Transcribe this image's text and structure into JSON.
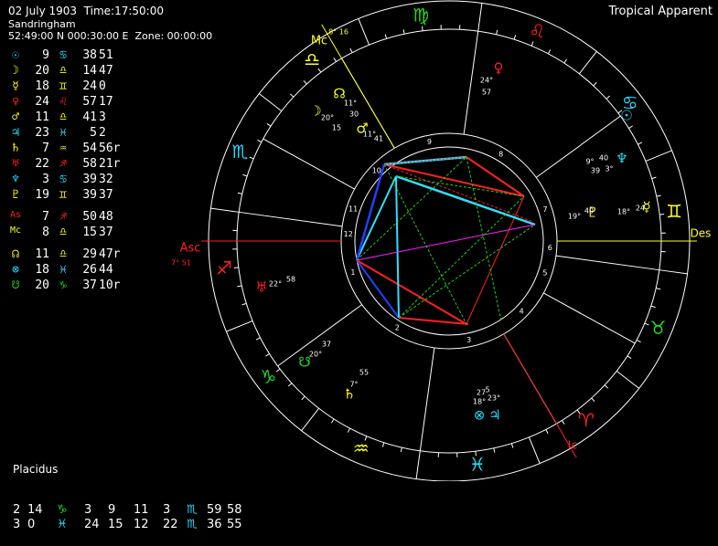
{
  "header": {
    "date": "02 July 1903",
    "time": "Time:17:50:00",
    "place": "Sandringham",
    "coords": "52:49:00 N 000:30:00 E  Zone: 00:00:00",
    "mode": "Tropical Apparent"
  },
  "colors": {
    "background": "#000000",
    "fire": "#ff2020",
    "earth": "#22dd22",
    "air": "#ffff22",
    "water": "#22ddff",
    "aspect_red": "#ff2020",
    "aspect_blue": "#2040ff",
    "aspect_cyan": "#30e0ff",
    "aspect_green": "#20cc20",
    "aspect_magenta": "#ff20ff"
  },
  "planets": [
    {
      "glyph": "☉",
      "name": "Sun",
      "deg": "9",
      "sign": "♋",
      "min": "38",
      "sec": "51",
      "color": "#22ddff"
    },
    {
      "glyph": "☽",
      "name": "Moon",
      "deg": "20",
      "sign": "♎",
      "min": "14",
      "sec": "47",
      "color": "#ffff22"
    },
    {
      "glyph": "☿",
      "name": "Mercury",
      "deg": "18",
      "sign": "♊",
      "min": "24",
      "sec": "0",
      "color": "#ffff22"
    },
    {
      "glyph": "♀",
      "name": "Venus",
      "deg": "24",
      "sign": "♌",
      "min": "57",
      "sec": "17",
      "color": "#ff2020"
    },
    {
      "glyph": "♂",
      "name": "Mars",
      "deg": "11",
      "sign": "♎",
      "min": "41",
      "sec": "3",
      "color": "#ffff22"
    },
    {
      "glyph": "♃",
      "name": "Jupiter",
      "deg": "23",
      "sign": "♓",
      "min": "5",
      "sec": "2",
      "color": "#22ddff"
    },
    {
      "glyph": "♄",
      "name": "Saturn",
      "deg": "7",
      "sign": "♒",
      "min": "54",
      "sec": "56r",
      "color": "#ffff22"
    },
    {
      "glyph": "♅",
      "name": "Uranus",
      "deg": "22",
      "sign": "♐",
      "min": "58",
      "sec": "21r",
      "color": "#ff2020"
    },
    {
      "glyph": "♆",
      "name": "Neptune",
      "deg": "3",
      "sign": "♋",
      "min": "39",
      "sec": "32",
      "color": "#22ddff"
    },
    {
      "glyph": "♇",
      "name": "Pluto",
      "deg": "19",
      "sign": "♊",
      "min": "39",
      "sec": "37",
      "color": "#ffff22"
    },
    {
      "glyph": "As",
      "name": "Ascendant",
      "deg": "7",
      "sign": "♐",
      "min": "50",
      "sec": "48",
      "color": "#ff2020"
    },
    {
      "glyph": "Mc",
      "name": "Midheaven",
      "deg": "8",
      "sign": "♎",
      "min": "15",
      "sec": "37",
      "color": "#ffff22"
    },
    {
      "glyph": "☊",
      "name": "North Node",
      "deg": "11",
      "sign": "♎",
      "min": "29",
      "sec": "47r",
      "color": "#ffff22"
    },
    {
      "glyph": "⊗",
      "name": "Part of Fortune",
      "deg": "18",
      "sign": "♓",
      "min": "26",
      "sec": "44",
      "color": "#22ddff"
    },
    {
      "glyph": "☋",
      "name": "South Node",
      "deg": "20",
      "sign": "♑",
      "min": "37",
      "sec": "10r",
      "color": "#22dd22"
    }
  ],
  "houses": {
    "title": "Placidus",
    "rows": [
      [
        {
          "t": "2",
          "c": "#ffffff"
        },
        {
          "t": "14",
          "c": "#ffffff"
        },
        {
          "t": "♑",
          "c": "#22dd22"
        },
        {
          "t": "3",
          "c": "#ffffff"
        },
        {
          "t": "9",
          "c": "#ffffff"
        },
        {
          "t": "11",
          "c": "#ffffff"
        },
        {
          "t": "3",
          "c": "#ffffff"
        },
        {
          "t": "♏",
          "c": "#22ddff"
        },
        {
          "t": "59",
          "c": "#ffffff"
        },
        {
          "t": "58",
          "c": "#ffffff"
        }
      ],
      [
        {
          "t": "3",
          "c": "#ffffff"
        },
        {
          "t": "0",
          "c": "#ffffff"
        },
        {
          "t": "♓",
          "c": "#22ddff"
        },
        {
          "t": "24",
          "c": "#ffffff"
        },
        {
          "t": "15",
          "c": "#ffffff"
        },
        {
          "t": "12",
          "c": "#ffffff"
        },
        {
          "t": "22",
          "c": "#ffffff"
        },
        {
          "t": "♏",
          "c": "#22ddff"
        },
        {
          "t": "36",
          "c": "#ffffff"
        },
        {
          "t": "55",
          "c": "#ffffff"
        }
      ]
    ]
  },
  "wheel": {
    "signs": [
      {
        "glyph": "♈",
        "color": "#ff2020"
      },
      {
        "glyph": "♉",
        "color": "#22dd22"
      },
      {
        "glyph": "♊",
        "color": "#ffff22"
      },
      {
        "glyph": "♋",
        "color": "#22ddff"
      },
      {
        "glyph": "♌",
        "color": "#ff2020"
      },
      {
        "glyph": "♍",
        "color": "#22dd22"
      },
      {
        "glyph": "♎",
        "color": "#ffff22"
      },
      {
        "glyph": "♏",
        "color": "#22ddff"
      },
      {
        "glyph": "♐",
        "color": "#ff2020"
      },
      {
        "glyph": "♑",
        "color": "#22dd22"
      },
      {
        "glyph": "♒",
        "color": "#ffff22"
      },
      {
        "glyph": "♓",
        "color": "#22ddff"
      }
    ],
    "asc_label": "Asc",
    "asc_deg": "7",
    "asc_min": "51",
    "mc_label": "Mc",
    "mc_deg": "8",
    "mc_min": "16",
    "des_label": "Des",
    "ic_label": "Ic",
    "house_numbers": [
      "1",
      "2",
      "3",
      "4",
      "5",
      "6",
      "7",
      "8",
      "9",
      "10",
      "11",
      "12"
    ],
    "planet_labels": [
      {
        "glyph": "♀",
        "color": "#ff2020",
        "deg": "24",
        "min": "57"
      },
      {
        "glyph": "☊",
        "color": "#ffff22",
        "deg": "11",
        "min": "30"
      },
      {
        "glyph": "☽",
        "color": "#ffff22",
        "deg": "20",
        "min": "15"
      },
      {
        "glyph": "♂",
        "color": "#ffff22",
        "deg": "11",
        "min": "41"
      },
      {
        "glyph": "☉",
        "color": "#22ddff",
        "deg": "9",
        "min": "39"
      },
      {
        "glyph": "♆",
        "color": "#22ddff",
        "deg": "3",
        "min": "40"
      },
      {
        "glyph": "♇",
        "color": "#ffff22",
        "deg": "19",
        "min": "40"
      },
      {
        "glyph": "☿",
        "color": "#ffff22",
        "deg": "18",
        "min": "24"
      },
      {
        "glyph": "♅",
        "color": "#ff2020",
        "deg": "22",
        "min": "58"
      },
      {
        "glyph": "☋",
        "color": "#22dd22",
        "deg": "20",
        "min": "37"
      },
      {
        "glyph": "♄",
        "color": "#ffff22",
        "deg": "7",
        "min": "55"
      },
      {
        "glyph": "⊗",
        "color": "#22ddff",
        "deg": "18",
        "min": "27"
      },
      {
        "glyph": "♃",
        "color": "#22ddff",
        "deg": "23",
        "min": "5"
      }
    ],
    "cusp_minute_label": {
      "deg": "11",
      "min": "30"
    }
  }
}
